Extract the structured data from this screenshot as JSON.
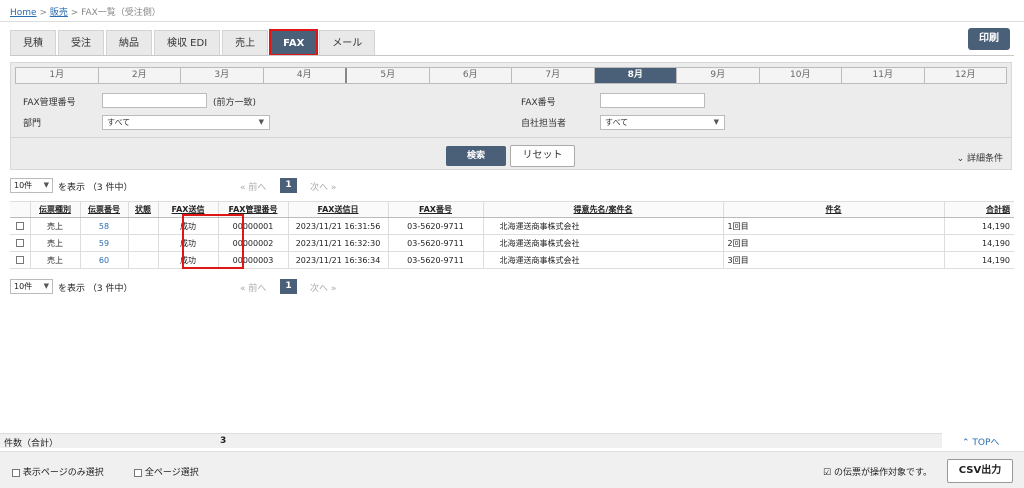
{
  "breadcrumb": {
    "home": "Home",
    "sep1": " > ",
    "sales": "販売",
    "sep2": " > ",
    "current": "FAX一覧（受注側）"
  },
  "tabs": [
    {
      "label": "見積"
    },
    {
      "label": "受注"
    },
    {
      "label": "納品"
    },
    {
      "label": "検収 EDI"
    },
    {
      "label": "売上"
    },
    {
      "label": "FAX",
      "active": true
    },
    {
      "label": "メール"
    }
  ],
  "print_label": "印刷",
  "months": [
    "1月",
    "2月",
    "3月",
    "4月",
    "5月",
    "6月",
    "7月",
    "8月",
    "9月",
    "10月",
    "11月",
    "12月"
  ],
  "active_month": "8月",
  "filters": {
    "fax_mgmt_label": "FAX管理番号",
    "fax_mgmt_value": "",
    "fax_mgmt_note": "(前方一致)",
    "dept_label": "部門",
    "dept_value": "すべて",
    "fax_no_label": "FAX番号",
    "fax_no_value": "",
    "staff_label": "自社担当者",
    "staff_value": "すべて"
  },
  "search_label": "検索",
  "reset_label": "リセット",
  "detail_label": "詳細条件",
  "pager": {
    "per_page": "10件",
    "summary": "を表示 （3 件中）",
    "prev": "« 前へ",
    "page": "1",
    "next": "次へ »"
  },
  "table": {
    "headers": [
      "伝票種別",
      "伝票番号",
      "状態",
      "FAX送信",
      "FAX管理番号",
      "FAX送信日",
      "FAX番号",
      "得意先名/案件名",
      "件名",
      "合計額"
    ],
    "rows": [
      {
        "type": "売上",
        "no": "58",
        "status": "",
        "fax": "成功",
        "mgmt": "00000001",
        "date": "2023/11/21 16:31:56",
        "faxno": "03-5620-9711",
        "customer": "北海運送商事株式会社",
        "subject": "1回目",
        "total": "14,190"
      },
      {
        "type": "売上",
        "no": "59",
        "status": "",
        "fax": "成功",
        "mgmt": "00000002",
        "date": "2023/11/21 16:32:30",
        "faxno": "03-5620-9711",
        "customer": "北海運送商事株式会社",
        "subject": "2回目",
        "total": "14,190"
      },
      {
        "type": "売上",
        "no": "60",
        "status": "",
        "fax": "成功",
        "mgmt": "00000003",
        "date": "2023/11/21 16:36:34",
        "faxno": "03-5620-9711",
        "customer": "北海運送商事株式会社",
        "subject": "3回目",
        "total": "14,190"
      }
    ]
  },
  "footer": {
    "count_label": "件数（合計）",
    "count_value": "3",
    "top_link": "⌃ TOPへ",
    "page_only": "表示ページのみ選択",
    "all_pages": "全ページ選択",
    "note": "の伝票が操作対象です。",
    "csv": "CSV出力"
  }
}
